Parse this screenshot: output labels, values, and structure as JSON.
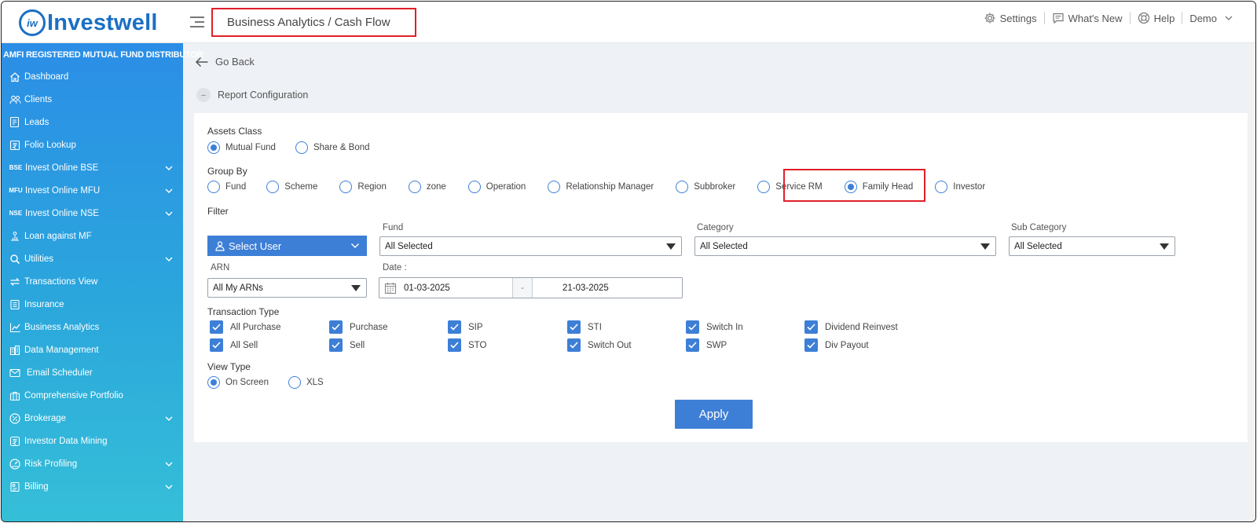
{
  "brand": {
    "badge": "iw",
    "name": "Investwell"
  },
  "header": {
    "title": "Business Analytics / Cash Flow",
    "settings": "Settings",
    "whats_new": "What's New",
    "help": "Help",
    "user": "Demo"
  },
  "sidebar": {
    "caption": "AMFI REGISTERED MUTUAL FUND DISTRIBUTOR",
    "items": [
      {
        "label": "Dashboard",
        "icon": "home-icon"
      },
      {
        "label": "Clients",
        "icon": "users-icon"
      },
      {
        "label": "Leads",
        "icon": "leads-icon"
      },
      {
        "label": "Folio Lookup",
        "icon": "rupee-doc-icon"
      },
      {
        "label": "Invest Online BSE",
        "tag": "BSE"
      },
      {
        "label": "Invest Online MFU",
        "tag": "MFU"
      },
      {
        "label": "Invest Online NSE",
        "tag": "NSE"
      },
      {
        "label": "Loan against MF",
        "icon": "loan-icon"
      },
      {
        "label": "Utilities",
        "icon": "utilities-icon"
      },
      {
        "label": "Transactions View",
        "icon": "transfer-icon"
      },
      {
        "label": "Insurance",
        "icon": "insurance-icon"
      },
      {
        "label": "Business Analytics",
        "icon": "chart-icon"
      },
      {
        "label": "Data Management",
        "icon": "database-icon"
      },
      {
        "label": "Email Scheduler",
        "icon": "email-icon"
      },
      {
        "label": "Comprehensive Portfolio",
        "icon": "briefcase-icon"
      },
      {
        "label": "Brokerage",
        "icon": "percent-icon"
      },
      {
        "label": "Investor Data Mining",
        "icon": "rupee-icon"
      },
      {
        "label": "Risk Profiling",
        "icon": "gauge-icon"
      },
      {
        "label": "Billing",
        "icon": "billing-icon"
      }
    ]
  },
  "nav": {
    "go_back": "Go Back",
    "report_config": "Report Configuration",
    "collapse": "–"
  },
  "form": {
    "assets_class": {
      "label": "Assets Class",
      "options": [
        "Mutual Fund",
        "Share & Bond"
      ],
      "selected": "Mutual Fund"
    },
    "group_by": {
      "label": "Group By",
      "options": [
        "Fund",
        "Scheme",
        "Region",
        "zone",
        "Operation",
        "Relationship Manager",
        "Subbroker",
        "Service RM",
        "Family Head",
        "Investor"
      ],
      "selected": "Family Head"
    },
    "filter": {
      "label": "Filter",
      "select_user": "Select User",
      "fund_label": "Fund",
      "fund_value": "All Selected",
      "category_label": "Category",
      "category_value": "All Selected",
      "sub_category_label": "Sub Category",
      "sub_category_value": "All Selected",
      "arn_label": "ARN",
      "arn_value": "All My ARNs",
      "date_label": "Date :",
      "date_from": "01-03-2025",
      "date_sep": "-",
      "date_to": "21-03-2025"
    },
    "transaction_type": {
      "label": "Transaction Type",
      "row1": [
        "All Purchase",
        "Purchase",
        "SIP",
        "STI",
        "Switch In",
        "Dividend Reinvest"
      ],
      "row2": [
        "All Sell",
        "Sell",
        "STO",
        "Switch Out",
        "SWP",
        "Div Payout"
      ]
    },
    "view_type": {
      "label": "View Type",
      "options": [
        "On Screen",
        "XLS"
      ],
      "selected": "On Screen"
    },
    "apply": "Apply"
  },
  "colors": {
    "accent": "#3d7fd6",
    "brand": "#1b6fc4",
    "highlight": "#e0202a"
  }
}
